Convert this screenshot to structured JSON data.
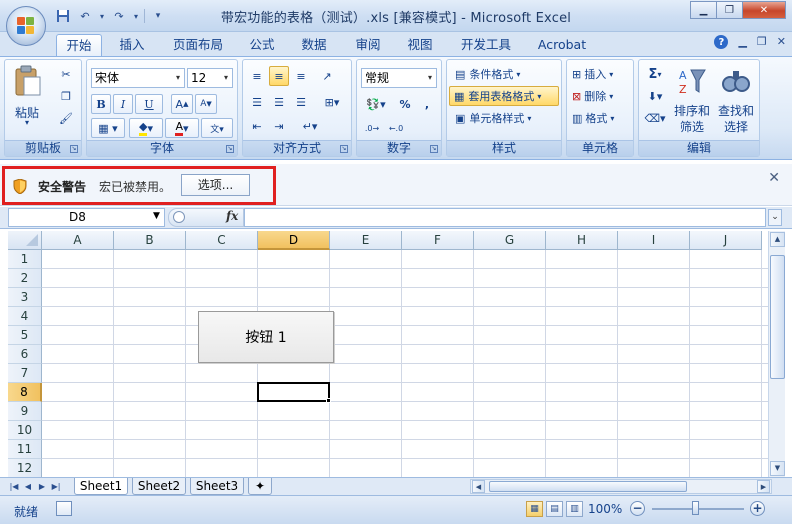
{
  "window": {
    "title": "带宏功能的表格（测试）.xls  [兼容模式] - Microsoft Excel"
  },
  "ribbon_tabs": [
    "开始",
    "插入",
    "页面布局",
    "公式",
    "数据",
    "审阅",
    "视图",
    "开发工具",
    "Acrobat"
  ],
  "active_tab": "开始",
  "clipboard": {
    "paste_label": "粘贴",
    "group_label": "剪贴板"
  },
  "font": {
    "name": "宋体",
    "size": "12",
    "group_label": "字体",
    "bold": "B",
    "italic": "I",
    "underline": "U"
  },
  "alignment": {
    "group_label": "对齐方式"
  },
  "number": {
    "format": "常规",
    "group_label": "数字",
    "percent": "%",
    "comma": ","
  },
  "styles": {
    "conditional": "条件格式",
    "table": "套用表格格式",
    "cell": "单元格样式",
    "group_label": "样式"
  },
  "cells": {
    "insert": "插入",
    "delete": "删除",
    "format": "格式",
    "group_label": "单元格"
  },
  "editing": {
    "sort_filter_1": "排序和",
    "sort_filter_2": "筛选",
    "find_select_1": "查找和",
    "find_select_2": "选择",
    "group_label": "编辑",
    "sigma": "Σ"
  },
  "security_bar": {
    "title": "安全警告",
    "message": "宏已被禁用。",
    "options_button": "选项..."
  },
  "formula_bar": {
    "name_box": "D8",
    "fx": "fx"
  },
  "columns": [
    "A",
    "B",
    "C",
    "D",
    "E",
    "F",
    "G",
    "H",
    "I",
    "J"
  ],
  "rows": [
    "1",
    "2",
    "3",
    "4",
    "5",
    "6",
    "7",
    "8",
    "9",
    "10",
    "11",
    "12"
  ],
  "selected_cell": {
    "column": "D",
    "row": "8"
  },
  "form_button": {
    "label": "按钮 1"
  },
  "sheets": [
    "Sheet1",
    "Sheet2",
    "Sheet3"
  ],
  "active_sheet": "Sheet1",
  "status": {
    "ready": "就绪",
    "zoom": "100%"
  },
  "colors": {
    "accent": "#15428b",
    "security_frame": "#e02020",
    "selected_header": "#f1c15f"
  }
}
